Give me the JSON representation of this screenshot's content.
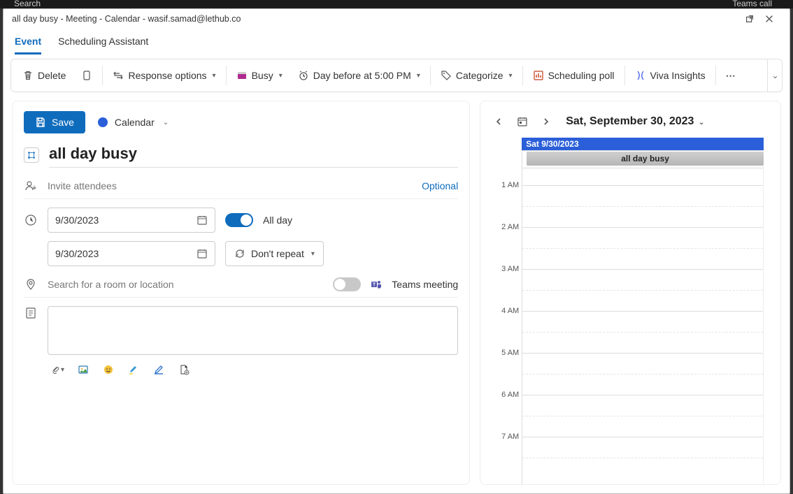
{
  "backdrop": {
    "search": "Search",
    "teams_call": "Teams call"
  },
  "window_title": "all day busy - Meeting - Calendar - wasif.samad@lethub.co",
  "tabs": {
    "event": "Event",
    "scheduling_assistant": "Scheduling Assistant"
  },
  "toolbar": {
    "delete": "Delete",
    "response_options": "Response options",
    "busy": "Busy",
    "reminder": "Day before at 5:00 PM",
    "categorize": "Categorize",
    "scheduling_poll": "Scheduling poll",
    "viva_insights": "Viva Insights"
  },
  "form": {
    "save": "Save",
    "calendar_picker": "Calendar",
    "title": "all day busy",
    "attendees_placeholder": "Invite attendees",
    "optional": "Optional",
    "start_date": "9/30/2023",
    "end_date": "9/30/2023",
    "all_day": "All day",
    "repeat": "Don't repeat",
    "location_placeholder": "Search for a room or location",
    "teams_meeting": "Teams meeting"
  },
  "side": {
    "date_label": "Sat, September 30, 2023",
    "day_header": "Sat 9/30/2023",
    "allday_event": "all day busy",
    "hours": [
      "1 AM",
      "2 AM",
      "3 AM",
      "4 AM",
      "5 AM",
      "6 AM",
      "7 AM"
    ]
  }
}
